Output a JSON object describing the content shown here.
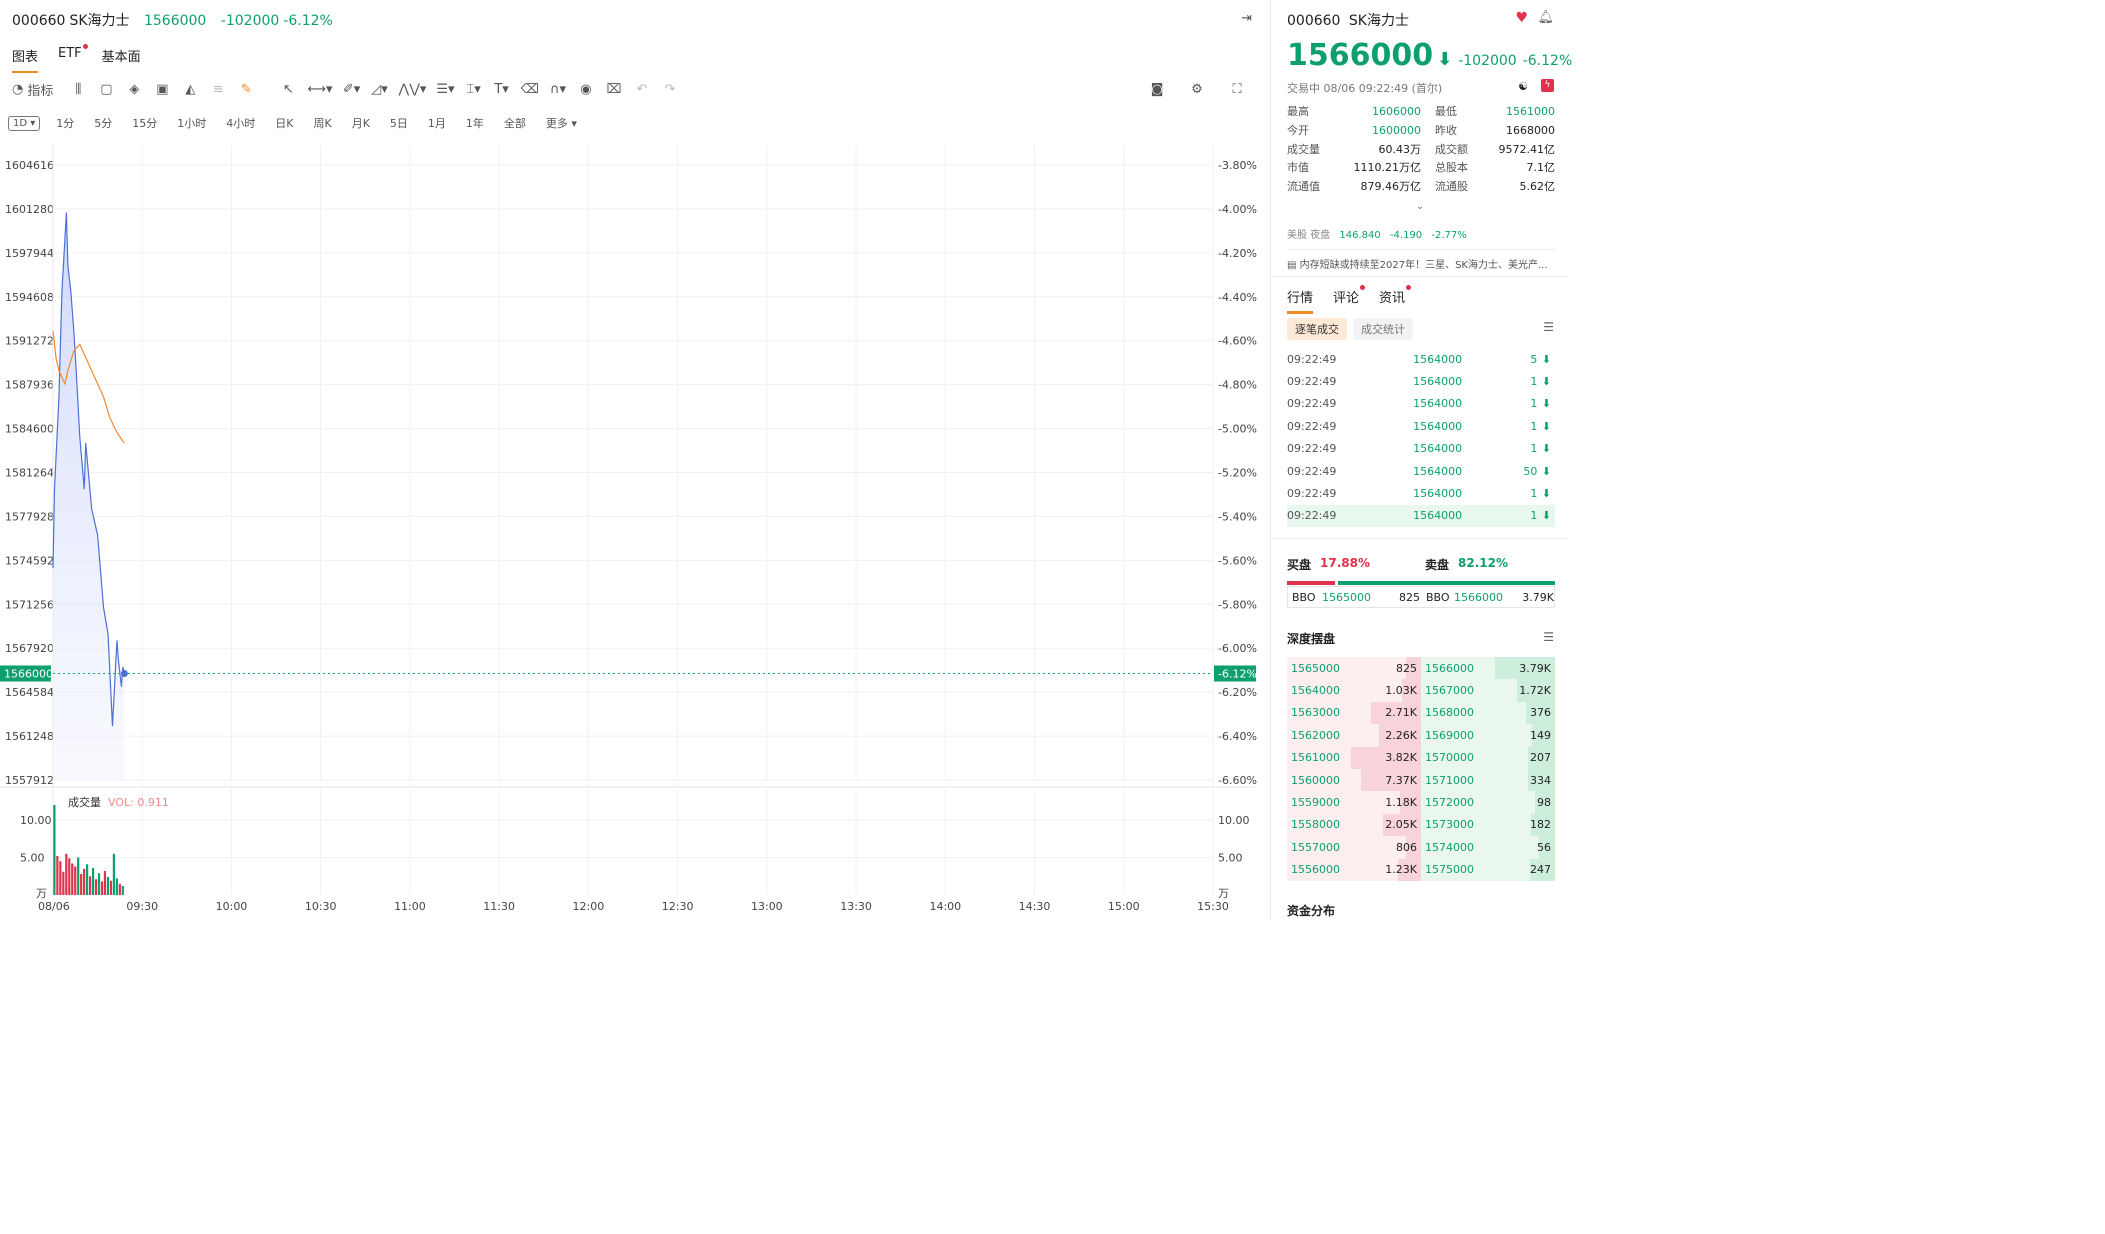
{
  "header": {
    "code": "000660",
    "name": "SK海力士",
    "price": "1566000",
    "change": "-102000",
    "pct": "-6.12%"
  },
  "tabs": [
    {
      "label": "图表",
      "dot": false
    },
    {
      "label": "ETF",
      "dot": true
    },
    {
      "label": "基本面",
      "dot": false
    }
  ],
  "toolbar": {
    "indicator": "指标"
  },
  "periods": {
    "selector": "1D",
    "items": [
      "1分",
      "5分",
      "15分",
      "1小时",
      "4小时",
      "日K",
      "周K",
      "月K",
      "5日",
      "1月",
      "1年",
      "全部"
    ],
    "more": "更多"
  },
  "chart_data": {
    "type": "line",
    "price_axis": [
      "1604616",
      "1601280",
      "1597944",
      "1594608",
      "1591272",
      "1587936",
      "1584600",
      "1581264",
      "1577928",
      "1574592",
      "1571256",
      "1567920",
      "1564584",
      "1561248",
      "1557912"
    ],
    "pct_axis": [
      "-3.80%",
      "-4.00%",
      "-4.20%",
      "-4.40%",
      "-4.60%",
      "-4.80%",
      "-5.00%",
      "-5.20%",
      "-5.40%",
      "-5.60%",
      "-5.80%",
      "-6.00%",
      "-6.20%",
      "-6.40%",
      "-6.60%"
    ],
    "ylim": [
      1557912,
      1604616
    ],
    "xlim_minutes": [
      540,
      930
    ],
    "x_ticks": [
      "08/06",
      "09:30",
      "10:00",
      "10:30",
      "11:00",
      "11:30",
      "12:00",
      "12:30",
      "13:00",
      "13:30",
      "14:00",
      "14:30",
      "15:00",
      "15:30"
    ],
    "x_tick_minutes": [
      540,
      570,
      600,
      630,
      660,
      690,
      720,
      750,
      780,
      810,
      840,
      870,
      900,
      930
    ],
    "current": {
      "price": 1566000,
      "label": "1566000",
      "pct_label": "-6.12%"
    },
    "series": [
      {
        "color": "#4f6fd8",
        "x": [
          540,
          540.5,
          542,
          543,
          544.5,
          545,
          546,
          547,
          547.8,
          549,
          550.5,
          551,
          552,
          553,
          555,
          557,
          558.5,
          560,
          561.5,
          562,
          563,
          563.5,
          564
        ],
        "y": [
          1574000,
          1580000,
          1587000,
          1595000,
          1601000,
          1597000,
          1595000,
          1592000,
          1589000,
          1584000,
          1580000,
          1583500,
          1581000,
          1578500,
          1576500,
          1571000,
          1569000,
          1562000,
          1568500,
          1567000,
          1565000,
          1566500,
          1566000
        ]
      },
      {
        "color": "#ee8a2e",
        "x": [
          540,
          541,
          542,
          543,
          544,
          545,
          547,
          549,
          551,
          553,
          555,
          557,
          559,
          561,
          563,
          564
        ],
        "y": [
          1592000,
          1590000,
          1589000,
          1588500,
          1588000,
          1589000,
          1590500,
          1591000,
          1590000,
          1589000,
          1588000,
          1587000,
          1585500,
          1584500,
          1583800,
          1583500
        ]
      }
    ],
    "volume": {
      "title": "成交量",
      "label": "VOL: 0.911",
      "yticks": [
        "10.00",
        "5.00",
        "万"
      ],
      "ylim": [
        0,
        12
      ],
      "bars": [
        12,
        5.2,
        4.5,
        3.1,
        5.5,
        4.9,
        4.2,
        3.8,
        5.0,
        2.8,
        3.5,
        4.1,
        2.5,
        3.6,
        2.1,
        2.9,
        1.8,
        3.2,
        2.4,
        1.9,
        5.5,
        2.2,
        1.5,
        1.2
      ],
      "colors": [
        "g",
        "r",
        "r",
        "r",
        "r",
        "r",
        "r",
        "r",
        "g",
        "r",
        "r",
        "g",
        "r",
        "g",
        "r",
        "g",
        "r",
        "r",
        "g",
        "r",
        "g",
        "g",
        "r",
        "g"
      ]
    }
  },
  "panel": {
    "code": "000660",
    "name": "SK海力士",
    "price": "1566000",
    "change": "-102000",
    "pct": "-6.12%",
    "trade_status": "交易中 08/06 09:22:49 (首尔)",
    "stats": [
      {
        "k1": "最高",
        "v1": "1606000",
        "c1": "g",
        "k2": "最低",
        "v2": "1561000",
        "c2": "g"
      },
      {
        "k1": "今开",
        "v1": "1600000",
        "c1": "g",
        "k2": "昨收",
        "v2": "1668000",
        "c2": ""
      },
      {
        "k1": "成交量",
        "v1": "60.43万",
        "c1": "",
        "k2": "成交额",
        "v2": "9572.41亿",
        "c2": ""
      },
      {
        "k1": "市值",
        "v1": "1110.21万亿",
        "c1": "",
        "k2": "总股本",
        "v2": "7.1亿",
        "c2": ""
      },
      {
        "k1": "流通值",
        "v1": "879.46万亿",
        "c1": "",
        "k2": "流通股",
        "v2": "5.62亿",
        "c2": ""
      }
    ],
    "night": {
      "label": "美股 夜盘",
      "price": "146.840",
      "change": "-4.190",
      "pct": "-2.77%"
    },
    "news": "内存短缺或持续至2027年！三星、SK海力士、美光产...",
    "tabs": [
      {
        "label": "行情",
        "dot": false
      },
      {
        "label": "评论",
        "dot": true
      },
      {
        "label": "资讯",
        "dot": true
      }
    ],
    "subtabs": [
      "逐笔成交",
      "成交统计"
    ],
    "ticks": [
      {
        "t": "09:22:49",
        "p": "1564000",
        "q": "5"
      },
      {
        "t": "09:22:49",
        "p": "1564000",
        "q": "1"
      },
      {
        "t": "09:22:49",
        "p": "1564000",
        "q": "1"
      },
      {
        "t": "09:22:49",
        "p": "1564000",
        "q": "1"
      },
      {
        "t": "09:22:49",
        "p": "1564000",
        "q": "1"
      },
      {
        "t": "09:22:49",
        "p": "1564000",
        "q": "50"
      },
      {
        "t": "09:22:49",
        "p": "1564000",
        "q": "1"
      },
      {
        "t": "09:22:49",
        "p": "1564000",
        "q": "1"
      }
    ],
    "buy_label": "买盘",
    "buy_pct": "17.88%",
    "sell_label": "卖盘",
    "sell_pct": "82.12%",
    "buy_ratio": 0.1788,
    "bbo": {
      "label": "BBO",
      "bid": "1565000",
      "bid_size": "825",
      "ask": "1566000",
      "ask_size": "3.79K"
    },
    "depth_title": "深度摆盘",
    "depth": [
      {
        "bp": "1565000",
        "bs": "825",
        "bf": 0.11,
        "ap": "1566000",
        "as": "3.79K",
        "af": 0.45
      },
      {
        "bp": "1564000",
        "bs": "1.03K",
        "bf": 0.14,
        "ap": "1567000",
        "as": "1.72K",
        "af": 0.28
      },
      {
        "bp": "1563000",
        "bs": "2.71K",
        "bf": 0.37,
        "ap": "1568000",
        "as": "376",
        "af": 0.22
      },
      {
        "bp": "1562000",
        "bs": "2.26K",
        "bf": 0.31,
        "ap": "1569000",
        "as": "149",
        "af": 0.17
      },
      {
        "bp": "1561000",
        "bs": "3.82K",
        "bf": 0.52,
        "ap": "1570000",
        "as": "207",
        "af": 0.2
      },
      {
        "bp": "1560000",
        "bs": "7.37K",
        "bf": 0.45,
        "ap": "1571000",
        "as": "334",
        "af": 0.2
      },
      {
        "bp": "1559000",
        "bs": "1.18K",
        "bf": 0.16,
        "ap": "1572000",
        "as": "98",
        "af": 0.15
      },
      {
        "bp": "1558000",
        "bs": "2.05K",
        "bf": 0.28,
        "ap": "1573000",
        "as": "182",
        "af": 0.18
      },
      {
        "bp": "1557000",
        "bs": "806",
        "bf": 0.11,
        "ap": "1574000",
        "as": "56",
        "af": 0.12
      },
      {
        "bp": "1556000",
        "bs": "1.23K",
        "bf": 0.17,
        "ap": "1575000",
        "as": "247",
        "af": 0.19
      }
    ],
    "fund_title": "资金分布"
  }
}
